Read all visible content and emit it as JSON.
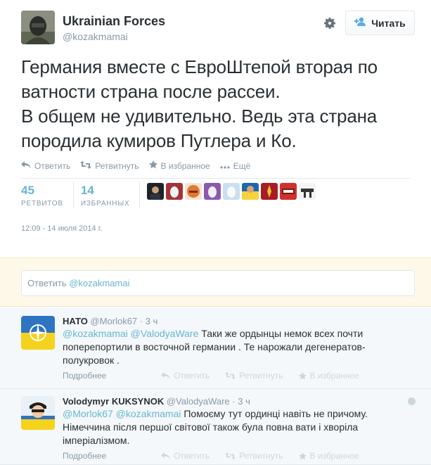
{
  "profile": {
    "name": "Ukrainian Forces",
    "username": "@kozakmamai",
    "follow_label": "Читать"
  },
  "tweet": {
    "text": "Германия вместе с ЕвроШтепой вторая по ватности страна после рассеи.\nВ общем не удивительно. Ведь эта страна породила кумиров Путлера и Ко.",
    "actions": {
      "reply": "Ответить",
      "retweet": "Ретвитнуть",
      "favorite": "В избранное",
      "more": "Ещё"
    },
    "stats": {
      "retweets_count": "45",
      "retweets_label": "РЕТВИТОВ",
      "favorites_count": "14",
      "favorites_label": "ИЗБРАННЫХ"
    },
    "timestamp": "12:09 - 14 июля 2014 г."
  },
  "reply_box": {
    "prefix": "Ответить",
    "mention": "@kozakmamai"
  },
  "replies": [
    {
      "name": "НАТО",
      "username": "@Morlok67",
      "time": "· 3 ч",
      "mentions": "@kozakmamai @ValodyaWare",
      "text": " Таки же ордынцы немок всех почти поперепортили в восточной германии . Те нарожали дегенератов-полукровок .",
      "more": "Подробнее",
      "reply": "Ответить",
      "retweet": "Ретвитнуть",
      "favorite": "В избранное"
    },
    {
      "name": "Volodymyr KUKSYNOK",
      "username": "@ValodyaWare",
      "time": "· 3 ч",
      "mentions": "@Morlok67 @kozakmamai",
      "text": " Помоєму тут ординці навіть не причому. Німеччина після першої світової також була повна вати і хворіла імперіалізмом.",
      "more": "Подробнее",
      "reply": "Ответить",
      "retweet": "Ретвитнуть",
      "favorite": "В избранное"
    }
  ],
  "colors": {
    "link": "#66b5d2",
    "muted": "#8899a6",
    "text": "#292f33",
    "reply_bg": "#f5f8fa",
    "compose_bg": "#fdf8e8"
  },
  "icons": [
    "gear-icon",
    "follow-person-icon",
    "reply-icon",
    "retweet-icon",
    "star-icon",
    "more-dots-icon"
  ]
}
